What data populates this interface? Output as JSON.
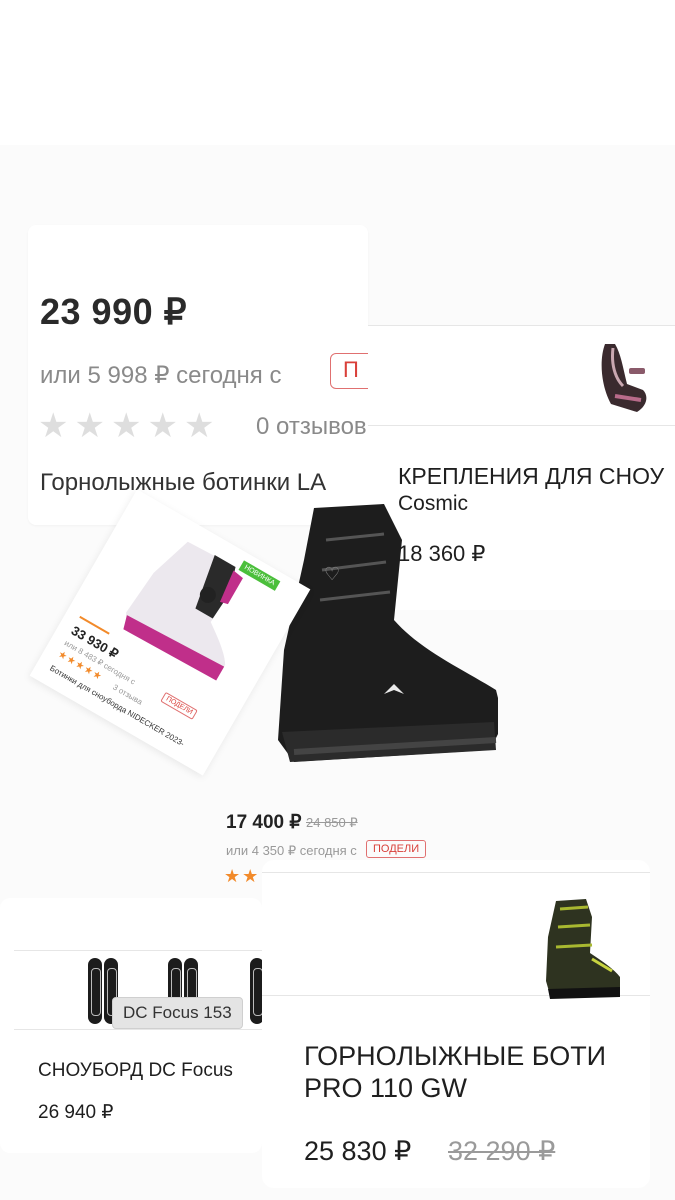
{
  "card_main": {
    "price": "23 990 ₽",
    "installment": "или 5 998 ₽ сегодня с",
    "installment_badge": "П",
    "reviews": "0 отзывов",
    "title": "Горнолыжные ботинки LA"
  },
  "card_bindings": {
    "title": "КРЕПЛЕНИЯ ДЛЯ СНОУ",
    "subtitle": "Cosmic",
    "price": "18 360 ₽"
  },
  "card_rotated": {
    "badge": "НОВИНКА",
    "price": "33 930 ₽",
    "installment": "или 8 483 ₽ сегодня с",
    "installment_badge": "ПОДЕЛИ",
    "stars": "★★★★★",
    "reviews": "3 отзыва",
    "name": "Ботинки для сноуборда NIDECKER 2023-"
  },
  "card_black": {
    "price": "17 400 ₽",
    "old_price": "24 850 ₽",
    "installment": "или 4 350 ₽ сегодня с",
    "installment_badge": "ПОДЕЛИ",
    "stars": "★★"
  },
  "card_snowboard": {
    "tooltip": "DC Focus 153",
    "title": "СНОУБОРД DC Focus",
    "price": "26 940 ₽"
  },
  "card_skiboots": {
    "title_line1": "ГОРНОЛЫЖНЫЕ БОТИ",
    "title_line2": "PRO 110 GW",
    "price": "25 830 ₽",
    "old_price": "32 290 ₽"
  },
  "colors": {
    "accent_orange": "#f28a2a",
    "installment_red": "#d9403a",
    "new_badge_green": "#4bbf3b"
  }
}
